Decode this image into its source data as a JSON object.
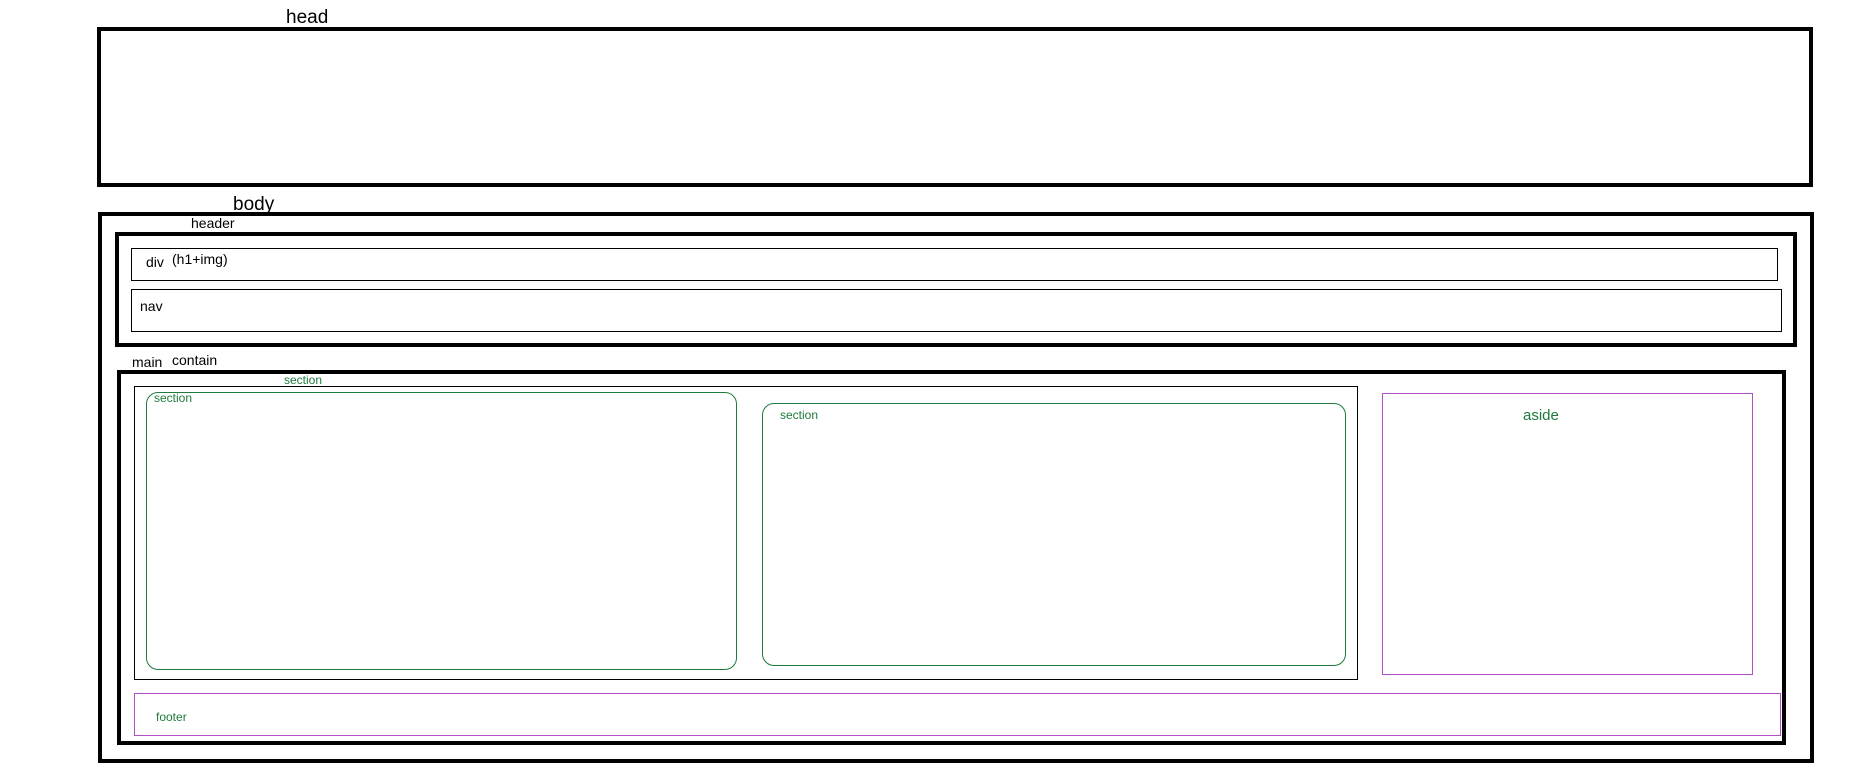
{
  "labels": {
    "head": "head",
    "body": "body",
    "header": "header",
    "div": "div",
    "div_content": "(h1+img)",
    "nav": "nav",
    "main": "main",
    "contain": "contain",
    "section_outer": "section",
    "section_left": "section",
    "section_right": "section",
    "aside": "aside",
    "footer": "footer"
  },
  "colors": {
    "outline": "#000000",
    "section": "#1e7a3c",
    "aside_footer": "#b14fc5"
  }
}
